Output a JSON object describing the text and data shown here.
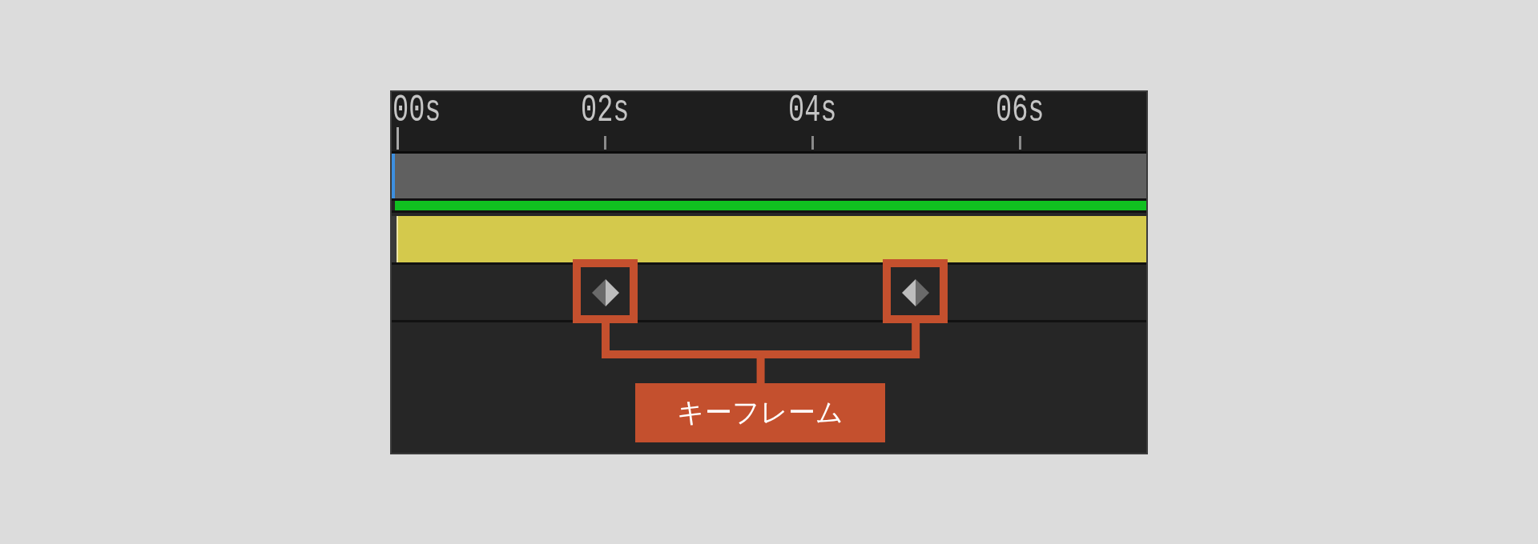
{
  "timeline": {
    "ruler": {
      "labels": [
        "00s",
        "02s",
        "04s",
        "06s"
      ]
    },
    "tracks": [
      {
        "kind": "layer-bar",
        "color": "#606060"
      },
      {
        "kind": "range-bar",
        "color": "#10c020"
      },
      {
        "kind": "clip-bar",
        "color": "#d4c94c"
      },
      {
        "kind": "keyframe-row",
        "keyframes": [
          {
            "level": 0.283,
            "mirrored": false,
            "highlighted": true
          },
          {
            "level": 0.694,
            "mirrored": true,
            "highlighted": true
          }
        ]
      }
    ]
  },
  "callout": {
    "label": "キーフレーム"
  }
}
